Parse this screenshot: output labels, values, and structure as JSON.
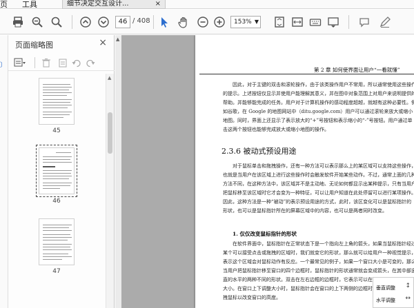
{
  "menubar": {
    "page_menu": "页",
    "tools_menu": "工具"
  },
  "doc_tab": {
    "title": "细节决定交互设计...",
    "close": "×"
  },
  "toolbar": {
    "page_current": "46",
    "page_total": "/ 408",
    "zoom": "153%",
    "icons": [
      "print-icon",
      "zoom-out-search-icon",
      "search-icon",
      "page-up-icon",
      "page-down-icon",
      "select-cursor-icon",
      "hand-icon",
      "zoom-out-icon",
      "zoom-in-icon",
      "fit-page-icon",
      "fit-width-icon",
      "comment-icon",
      "pen-icon"
    ]
  },
  "panel": {
    "title": "页面缩略图",
    "close": "×",
    "thumbs": [
      {
        "label": "45"
      },
      {
        "label": "46"
      },
      {
        "label": "47"
      }
    ]
  },
  "page": {
    "header": "第 2 章   如何使界面让用户“一看就懂”",
    "para1": "因此，对于主键的双击和滚轮操作，由于该类操作用户不常用，所以通常使用这些操作的提示。上述按钮仅显示并使用户能理解其意义，并在图中对象范围上对用户来说明提供的帮助。并能够能完成的任务。用户对于计算机操作的感动程度超越，就越有这种必要性。例如谷歌，在 Google 的地图网站中（ditu.google.com）用户可以通过滚轮来放大或缩小地图。同时，界面上还显示了表示放大的“+”号按钮和表示缩小的“-”号按钮。用户通过单击这两个按钮也能够完成放大或缩小地图的操作。",
    "section": "2.3.6   被动式预设用途",
    "para2": "对于鼠标单击和拖拽操作，还有一种方法可以表示那么上的某区域可以支持这些操作，也就是当用户在该区域上进行这些操作时会触发软件开始某些动作。不过，通常上面的几种方法不同，在这种方法中，该区域并不是主动地、无论如何都显示出某种提示，只有当用户把鼠标移至该区域时它才会变为一种特征，可以让用户知道在此处停留可以进行某项操作。因此，这种方法是一种“被动”的表示预设用途的方式，此时，该区变化可以是鼠标指针的形状，也可以是鼠标指针所在的屏幕区域中的内容，也可以是两者同时改变。",
    "subsection": "1. 仅仅改变鼠标指针的形状",
    "para3": "在软件界面中，鼠标指针在正常状态下是一个指向左上角的箭头，如果当鼠标指针经过某个可以接受点击或拖拽的区域时，我们就变它的形状，那么就可以给用户一种视觉提示，表示这个区域会对鼠标动作有反应。一个最常见的例子，如果一个窗口大小是可变的，那么当用户把鼠标指针移至窗口的四个边框时，鼠标指针的形状通常就会变成箭头，在其中部竖直的水平的两种不同的形状。双击在左右边框的边框时，它表示可以在水平线调整在窗口的大小。在窗口上下调整大小时，鼠标指针会在窗口的上下两侧的边框时，它表示可以上下拖拽鼠标以改变窗口的高度。"
  },
  "floatbox": {
    "row1": "垂直调整",
    "row2": "水平调整"
  }
}
